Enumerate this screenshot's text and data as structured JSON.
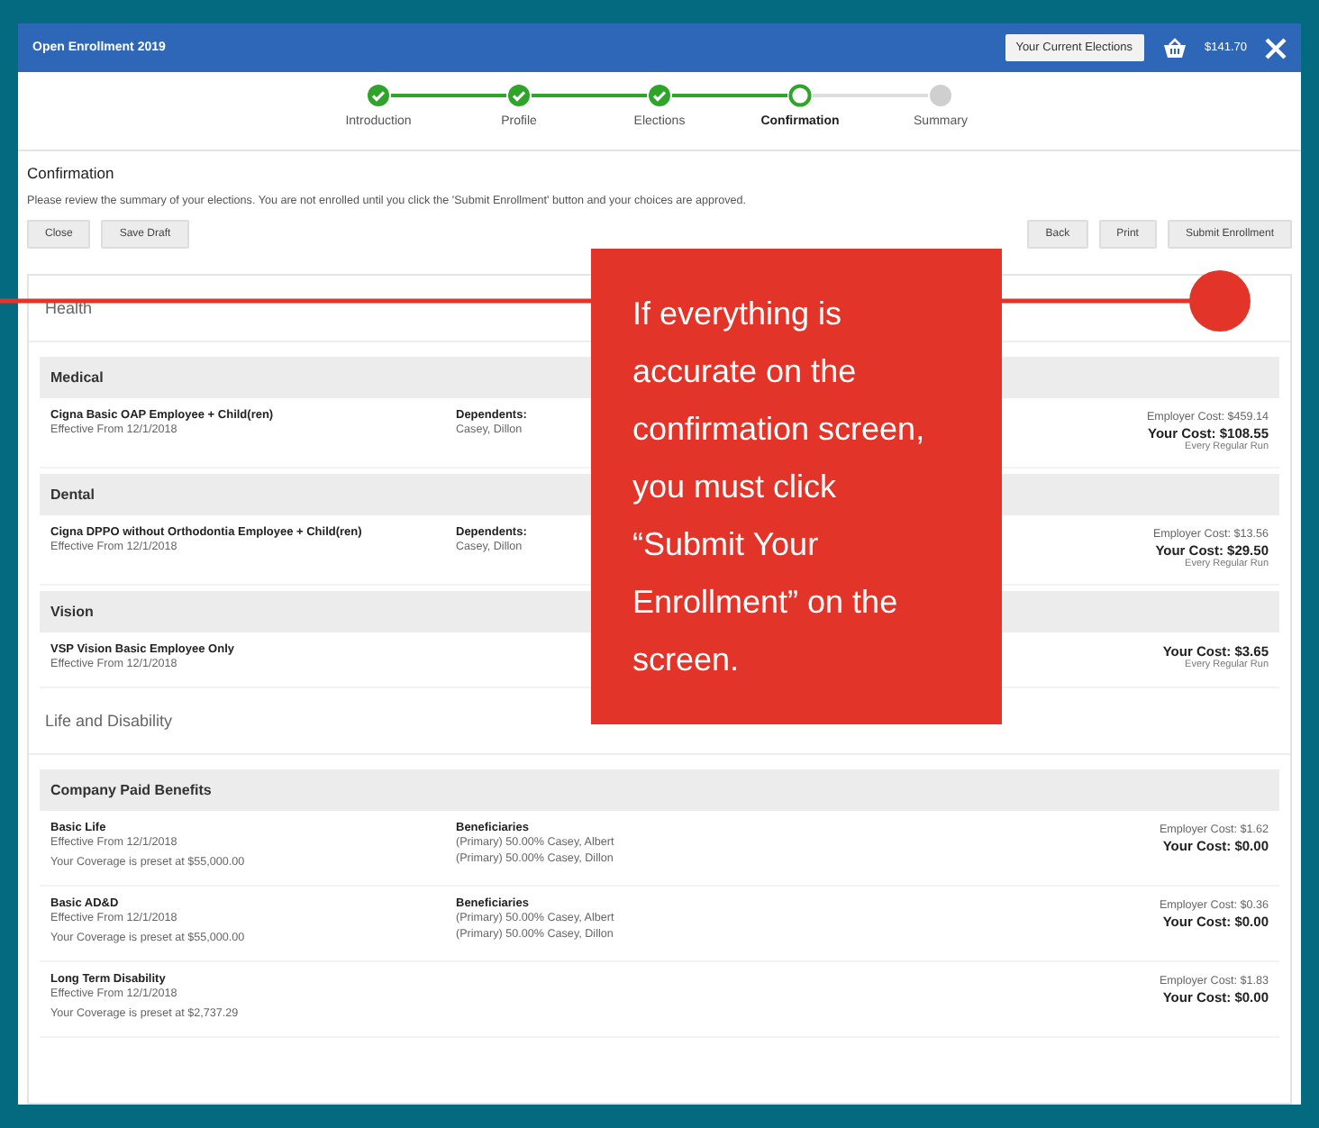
{
  "window": {
    "title": "Open Enrollment 2019",
    "header_button": "Your Current Elections",
    "cart_total": "$141.70"
  },
  "steps": [
    {
      "label": "Introduction",
      "completed": true,
      "selected": false
    },
    {
      "label": "Profile",
      "completed": true,
      "selected": false
    },
    {
      "label": "Elections",
      "completed": true,
      "selected": false
    },
    {
      "label": "Confirmation",
      "completed": false,
      "selected": true
    },
    {
      "label": "Summary",
      "completed": false,
      "selected": false
    }
  ],
  "page": {
    "title": "Confirmation",
    "note": "Please review the summary of your elections. You are not enrolled until you click the 'Submit Enrollment' button and your choices are approved.",
    "left_buttons": [
      "Close",
      "Save Draft"
    ],
    "right_buttons": [
      "Back",
      "Print",
      "Submit Enrollment"
    ]
  },
  "groups": [
    {
      "title": "Health",
      "sections": [
        {
          "title": "Medical",
          "items": [
            {
              "name": "Cigna Basic OAP Employee + Child(ren)",
              "effective": "Effective From 12/1/2018",
              "people_label": "Dependents:",
              "people": [
                "Casey, Dillon"
              ],
              "employer_cost": "Employer Cost: $459.14",
              "your_cost": "Your Cost: $108.55",
              "frequency": "Every Regular Run"
            }
          ]
        },
        {
          "title": "Dental",
          "items": [
            {
              "name": "Cigna DPPO without Orthodontia Employee + Child(ren)",
              "effective": "Effective From 12/1/2018",
              "people_label": "Dependents:",
              "people": [
                "Casey, Dillon"
              ],
              "employer_cost": "Employer Cost: $13.56",
              "your_cost": "Your Cost: $29.50",
              "frequency": "Every Regular Run"
            }
          ]
        },
        {
          "title": "Vision",
          "items": [
            {
              "name": "VSP Vision Basic Employee Only",
              "effective": "Effective From 12/1/2018",
              "your_cost": "Your Cost: $3.65",
              "frequency": "Every Regular Run"
            }
          ]
        }
      ]
    },
    {
      "title": "Life and Disability",
      "sections": [
        {
          "title": "Company Paid Benefits",
          "items": [
            {
              "name": "Basic Life",
              "effective": "Effective From 12/1/2018",
              "coverage": "Your Coverage is preset at $55,000.00",
              "people_label": "Beneficiaries",
              "people": [
                "(Primary) 50.00% Casey, Albert",
                "(Primary) 50.00% Casey, Dillon"
              ],
              "employer_cost": "Employer Cost: $1.62",
              "your_cost": "Your Cost: $0.00"
            },
            {
              "name": "Basic AD&D",
              "effective": "Effective From 12/1/2018",
              "coverage": "Your Coverage is preset at $55,000.00",
              "people_label": "Beneficiaries",
              "people": [
                "(Primary) 50.00% Casey, Albert",
                "(Primary) 50.00% Casey, Dillon"
              ],
              "employer_cost": "Employer Cost: $0.36",
              "your_cost": "Your Cost: $0.00"
            },
            {
              "name": "Long Term Disability",
              "effective": "Effective From 12/1/2018",
              "coverage": "Your Coverage is preset at $2,737.29",
              "employer_cost": "Employer Cost: $1.83",
              "your_cost": "Your Cost: $0.00"
            }
          ]
        }
      ]
    }
  ],
  "callout": {
    "text": "If everything is accurate on the confirmation screen, you must click “Submit Your Enrollment” on the screen."
  }
}
